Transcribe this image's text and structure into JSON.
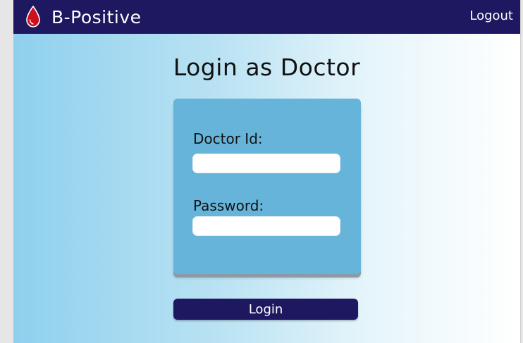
{
  "navbar": {
    "brand_name": "B-Positive",
    "brand_icon": "blood-drop-icon",
    "logout_label": "Logout"
  },
  "main": {
    "title": "Login as Doctor",
    "form": {
      "doctor_id_label": "Doctor Id:",
      "doctor_id_value": "",
      "password_label": "Password:",
      "password_value": ""
    },
    "login_label": "Login"
  },
  "colors": {
    "navbar": "#1d1860",
    "card": "#66b4da",
    "drop": "#cc1020"
  }
}
